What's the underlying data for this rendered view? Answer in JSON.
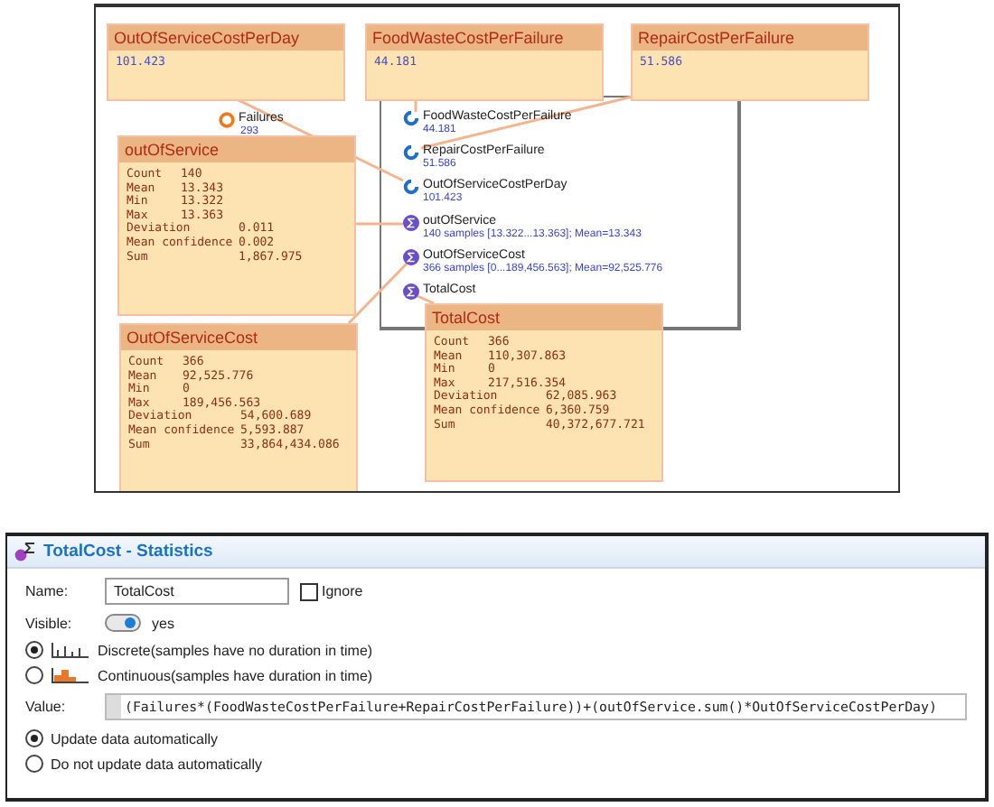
{
  "canvas": {
    "parameter_boxes": [
      {
        "title": "OutOfServiceCostPerDay",
        "value": "101.423"
      },
      {
        "title": "FoodWasteCostPerFailure",
        "value": "44.181"
      },
      {
        "title": "RepairCostPerFailure",
        "value": "51.586"
      }
    ],
    "failures": {
      "name": "Failures",
      "value": "293"
    },
    "model_items": [
      {
        "kind": "parameter",
        "name": "FoodWasteCostPerFailure",
        "detail": "44.181"
      },
      {
        "kind": "parameter",
        "name": "RepairCostPerFailure",
        "detail": "51.586"
      },
      {
        "kind": "parameter",
        "name": "OutOfServiceCostPerDay",
        "detail": "101.423"
      },
      {
        "kind": "statistics",
        "name": "outOfService",
        "detail": "140 samples [13.322...13.363]; Mean=13.343"
      },
      {
        "kind": "statistics",
        "name": "OutOfServiceCost",
        "detail": "366 samples [0...189,456.563]; Mean=92,525.776"
      },
      {
        "kind": "statistics",
        "name": "TotalCost"
      }
    ],
    "stat_boxes": [
      {
        "title": "outOfService",
        "rows": [
          {
            "label": "Count",
            "value": "140"
          },
          {
            "label": "Mean",
            "value": "13.343"
          },
          {
            "label": "Min",
            "value": "13.322"
          },
          {
            "label": "Max",
            "value": "13.363"
          },
          {
            "label": "Deviation",
            "value": "0.011"
          },
          {
            "label": "Mean confidence",
            "value": "0.002"
          },
          {
            "label": "Sum",
            "value": "1,867.975"
          }
        ]
      },
      {
        "title": "OutOfServiceCost",
        "rows": [
          {
            "label": "Count",
            "value": "366"
          },
          {
            "label": "Mean",
            "value": "92,525.776"
          },
          {
            "label": "Min",
            "value": "0"
          },
          {
            "label": "Max",
            "value": "189,456.563"
          },
          {
            "label": "Deviation",
            "value": "54,600.689"
          },
          {
            "label": "Mean confidence",
            "value": "5,593.887"
          },
          {
            "label": "Sum",
            "value": "33,864,434.086"
          }
        ]
      },
      {
        "title": "TotalCost",
        "rows": [
          {
            "label": "Count",
            "value": "366"
          },
          {
            "label": "Mean",
            "value": "110,307.863"
          },
          {
            "label": "Min",
            "value": "0"
          },
          {
            "label": "Max",
            "value": "217,516.354"
          },
          {
            "label": "Deviation",
            "value": "62,085.963"
          },
          {
            "label": "Mean confidence",
            "value": "6,360.759"
          },
          {
            "label": "Sum",
            "value": "40,372,677.721"
          }
        ]
      }
    ]
  },
  "statistics_panel": {
    "title": "TotalCost - Statistics",
    "name_label": "Name:",
    "name_value": "TotalCost",
    "ignore": {
      "label": "Ignore",
      "checked": false
    },
    "visible_label": "Visible:",
    "visible": {
      "label": "yes",
      "on": true
    },
    "sample_types": [
      {
        "kind": "discrete",
        "label": "Discrete(samples have no duration in time)",
        "selected": true
      },
      {
        "kind": "continuous",
        "label": "Continuous(samples have duration in time)",
        "selected": false
      }
    ],
    "value_label": "Value:",
    "value": "(Failures*(FoodWasteCostPerFailure+RepairCostPerFailure))+(outOfService.sum()*OutOfServiceCostPerDay)",
    "update_options": [
      {
        "label": "Update data automatically",
        "selected": true
      },
      {
        "label": "Do not update data automatically",
        "selected": false
      }
    ]
  }
}
